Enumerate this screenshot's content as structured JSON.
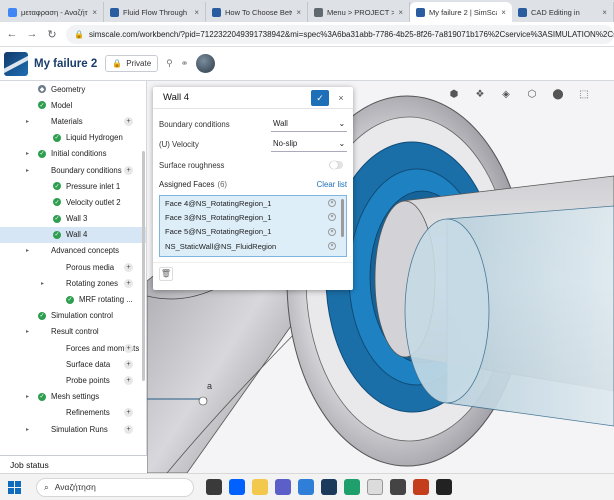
{
  "browser": {
    "tabs": [
      {
        "title": "μεταφραση - Αναζήτ",
        "color": "#4285f4",
        "active": false
      },
      {
        "title": "Fluid Flow Through",
        "color": "#2a5d9f",
        "active": false
      },
      {
        "title": "How To Choose Betw",
        "color": "#2a5d9f",
        "active": false
      },
      {
        "title": "Menu > PROJECT >",
        "color": "#606870",
        "active": false
      },
      {
        "title": "My failure 2 | SimSca",
        "color": "#2a5d9f",
        "active": true
      },
      {
        "title": "CAD Editing in",
        "color": "#2a5d9f",
        "active": false
      }
    ],
    "tab_close": "×",
    "url": "simscale.com/workbench/?pid=7122322049391738942&mi=spec%3A6ba31abb-7786-4b25-8f26-7a819071b176%2Cservice%3ASIMULATION%2Cs",
    "lock_icon": "🔒",
    "back": "←",
    "forward": "→",
    "reload": "↻"
  },
  "app": {
    "project_name": "My failure 2",
    "private_label": "Private",
    "lock_glyph": "🔒",
    "share_glyph": "⚲",
    "link_glyph": "⚭"
  },
  "tree": [
    {
      "label": "Geometry",
      "indent": 38,
      "icon": "geometry",
      "caret": false,
      "plus": false
    },
    {
      "label": "Model",
      "indent": 38,
      "icon": "check",
      "caret": false,
      "plus": false
    },
    {
      "label": "Materials",
      "indent": 38,
      "icon": "none",
      "caret": true,
      "plus": true
    },
    {
      "label": "Liquid Hydrogen",
      "indent": 53,
      "icon": "check",
      "caret": false,
      "plus": false
    },
    {
      "label": "Initial conditions",
      "indent": 38,
      "icon": "check",
      "caret": true,
      "plus": false
    },
    {
      "label": "Boundary conditions",
      "indent": 38,
      "icon": "none",
      "caret": true,
      "plus": true
    },
    {
      "label": "Pressure inlet 1",
      "indent": 53,
      "icon": "check",
      "caret": false,
      "plus": false
    },
    {
      "label": "Velocity outlet 2",
      "indent": 53,
      "icon": "check",
      "caret": false,
      "plus": false
    },
    {
      "label": "Wall 3",
      "indent": 53,
      "icon": "check",
      "caret": false,
      "plus": false
    },
    {
      "label": "Wall 4",
      "indent": 53,
      "icon": "check",
      "caret": false,
      "plus": false,
      "selected": true
    },
    {
      "label": "Advanced concepts",
      "indent": 38,
      "icon": "none",
      "caret": true,
      "plus": false
    },
    {
      "label": "Porous media",
      "indent": 53,
      "icon": "none",
      "caret": false,
      "plus": true
    },
    {
      "label": "Rotating zones",
      "indent": 53,
      "icon": "none",
      "caret": true,
      "plus": true
    },
    {
      "label": "MRF rotating ...",
      "indent": 66,
      "icon": "check",
      "caret": false,
      "plus": false
    },
    {
      "label": "Simulation control",
      "indent": 38,
      "icon": "check",
      "caret": false,
      "plus": false
    },
    {
      "label": "Result control",
      "indent": 38,
      "icon": "none",
      "caret": true,
      "plus": false
    },
    {
      "label": "Forces and moments",
      "indent": 53,
      "icon": "none",
      "caret": false,
      "plus": true
    },
    {
      "label": "Surface data",
      "indent": 53,
      "icon": "none",
      "caret": false,
      "plus": true
    },
    {
      "label": "Probe points",
      "indent": 53,
      "icon": "none",
      "caret": false,
      "plus": true
    },
    {
      "label": "Mesh settings",
      "indent": 38,
      "icon": "check",
      "caret": true,
      "plus": false
    },
    {
      "label": "Refinements",
      "indent": 53,
      "icon": "none",
      "caret": false,
      "plus": true
    },
    {
      "label": "Simulation Runs",
      "indent": 38,
      "icon": "none",
      "caret": true,
      "plus": true
    }
  ],
  "job_status": "Job status",
  "dialog": {
    "title": "Wall 4",
    "confirm_glyph": "✓",
    "close_glyph": "×",
    "boundary_label": "Boundary conditions",
    "boundary_value": "Wall",
    "velocity_label": "(U) Velocity",
    "velocity_value": "No-slip",
    "roughness_label": "Surface roughness",
    "assigned_label": "Assigned Faces",
    "assigned_count": "(6)",
    "clear_label": "Clear list",
    "faces": [
      "Face 4@NS_RotatingRegion_1",
      "Face 3@NS_RotatingRegion_1",
      "Face 5@NS_RotatingRegion_1",
      "NS_StaticWall@NS_FluidRegion"
    ],
    "remove_glyph": "×",
    "trash_glyph": "🗑",
    "chevron": "⌄"
  },
  "viewport": {
    "label_text": "a"
  },
  "taskbar": {
    "search_placeholder": "Αναζήτηση",
    "search_glyph": "⌕"
  },
  "colors": {
    "accent": "#1d6fb8",
    "check": "#2e9e4f",
    "selection": "#d6e6f5",
    "face_highlight": "#1a6fa8"
  }
}
